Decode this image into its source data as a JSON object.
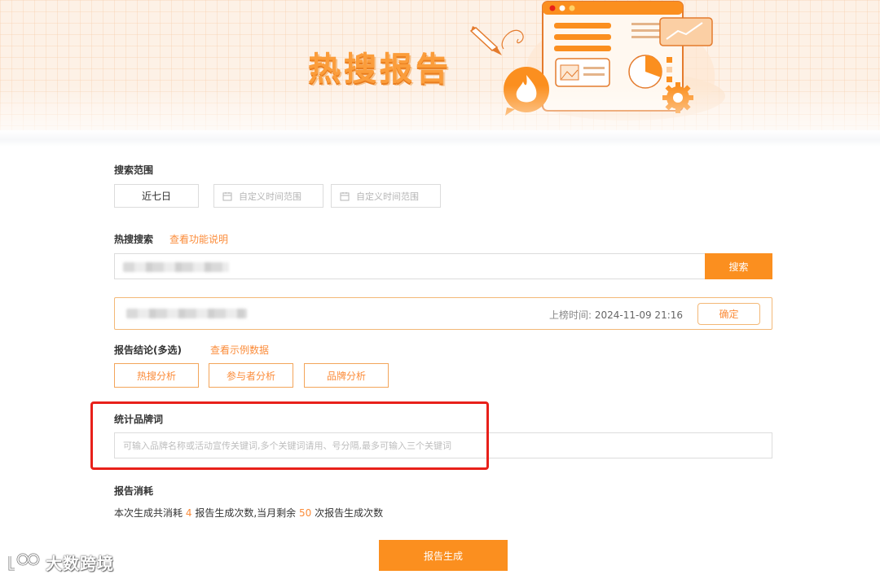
{
  "banner": {
    "title": "热搜报告"
  },
  "search_range": {
    "label": "搜索范围",
    "preset_label": "近七日",
    "start_placeholder": "自定义时间范围",
    "end_placeholder": "自定义时间范围"
  },
  "hot_search": {
    "label": "热搜搜索",
    "help_link": "查看功能说明",
    "search_button": "搜索",
    "result": {
      "time_label": "上榜时间:",
      "time_value": "2024-11-09 21:16",
      "confirm_button": "确定"
    }
  },
  "report_conclusion": {
    "label": "报告结论(多选)",
    "example_link": "查看示例数据",
    "options": [
      {
        "label": "热搜分析"
      },
      {
        "label": "参与者分析"
      },
      {
        "label": "品牌分析"
      }
    ]
  },
  "brand_words": {
    "label": "统计品牌词",
    "placeholder": "可输入品牌名称或活动宣传关键词,多个关键词请用、号分隔,最多可输入三个关键词"
  },
  "consumption": {
    "label": "报告消耗",
    "text_prefix": "本次生成共消耗",
    "consume_count": "4",
    "text_middle": "报告生成次数,当月剩余",
    "remaining_count": "50",
    "text_suffix": "次报告生成次数"
  },
  "generate_button": "报告生成",
  "watermark": {
    "text": "大数跨境"
  },
  "colors": {
    "accent": "#fb8f1f",
    "link": "#fb8c3a",
    "highlight_frame": "#e8201a"
  }
}
